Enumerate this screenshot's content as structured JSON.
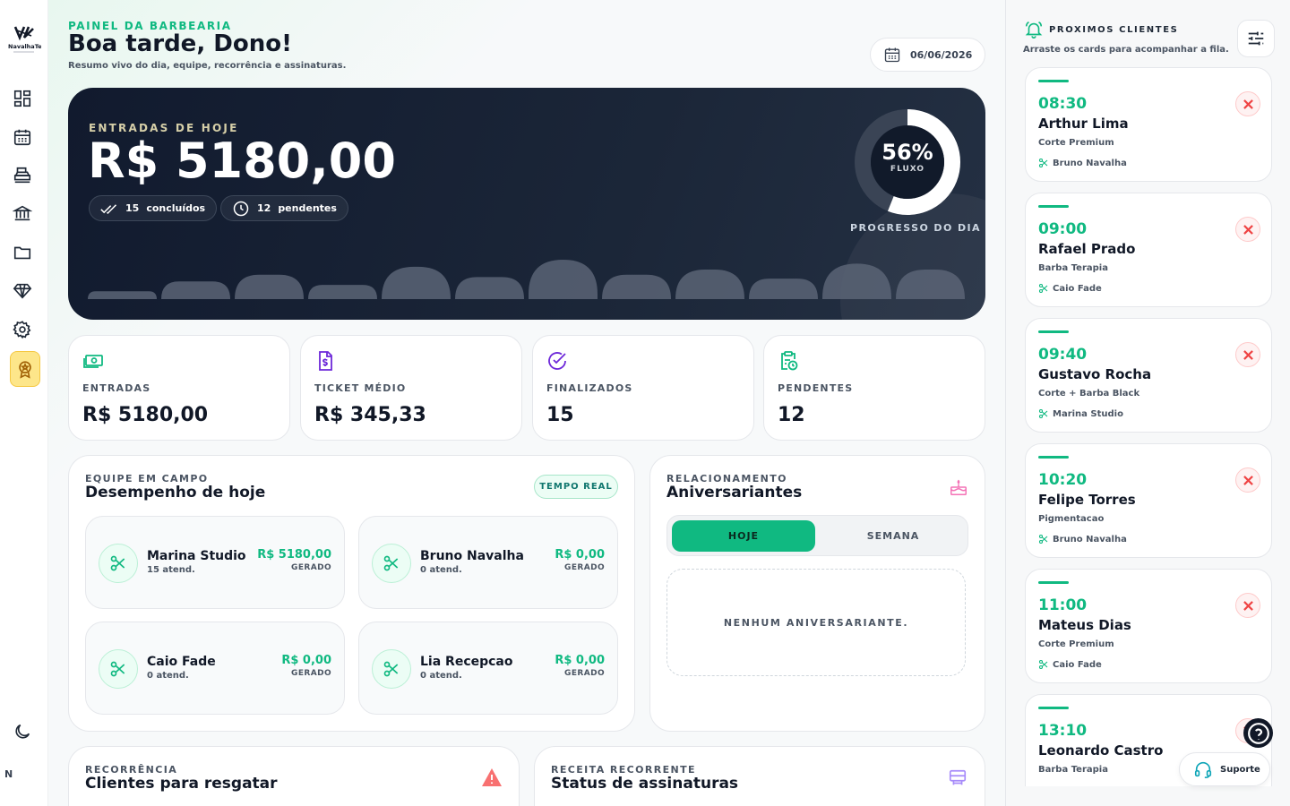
{
  "sidebar": {
    "logo_text": "NavalhaTec",
    "items": [
      {
        "icon": "dashboard-icon"
      },
      {
        "icon": "calendar-icon"
      },
      {
        "icon": "cash-register-icon"
      },
      {
        "icon": "bank-icon"
      },
      {
        "icon": "folder-icon"
      },
      {
        "icon": "diamond-icon"
      },
      {
        "icon": "gear-icon"
      },
      {
        "icon": "award-badge-icon"
      }
    ],
    "theme_icon": "moon-icon",
    "user_initial": "N"
  },
  "header": {
    "eyebrow": "PAINEL DA BARBEARIA",
    "title": "Boa tarde, Dono!",
    "subtitle": "Resumo vivo do dia, equipe, recorrência e assinaturas.",
    "date": "06/06/2026"
  },
  "hero": {
    "eyebrow": "ENTRADAS DE HOJE",
    "value": "R$ 5180,00",
    "chips": {
      "done_count": "15",
      "done_label": "concluídos",
      "pending_count": "12",
      "pending_label": "pendentes"
    },
    "progress": {
      "percent_text": "56%",
      "percent": 0.56,
      "label": "FLUXO",
      "caption": "PROGRESSO DO DIA"
    },
    "bars": [
      0.2,
      0.45,
      0.62,
      0.36,
      0.82,
      0.56,
      1.0,
      0.62,
      0.75,
      0.52,
      0.9,
      0.75
    ],
    "colors": {
      "track": "#3a4455",
      "fill": "#ffffff",
      "bar": "#5b6475"
    }
  },
  "stats": [
    {
      "label": "ENTRADAS",
      "value": "R$ 5180,00",
      "icon": "money-icon",
      "color": "#10b981"
    },
    {
      "label": "TICKET MÉDIO",
      "value": "R$ 345,33",
      "icon": "invoice-dollar-icon",
      "color": "#6d28d9"
    },
    {
      "label": "FINALIZADOS",
      "value": "15",
      "icon": "check-circle-icon",
      "color": "#6d28d9"
    },
    {
      "label": "PENDENTES",
      "value": "12",
      "icon": "clipboard-clock-icon",
      "color": "#10b981"
    }
  ],
  "team": {
    "eyebrow": "EQUIPE EM CAMPO",
    "title": "Desempenho de hoje",
    "badge": "TEMPO REAL",
    "members": [
      {
        "name": "Marina Studio",
        "count": "15 atend.",
        "amount": "R$ 5180,00",
        "tag": "GERADO"
      },
      {
        "name": "Bruno Navalha",
        "count": "0 atend.",
        "amount": "R$ 0,00",
        "tag": "GERADO"
      },
      {
        "name": "Caio Fade",
        "count": "0 atend.",
        "amount": "R$ 0,00",
        "tag": "GERADO"
      },
      {
        "name": "Lia Recepcao",
        "count": "0 atend.",
        "amount": "R$ 0,00",
        "tag": "GERADO"
      }
    ]
  },
  "birthdays": {
    "eyebrow": "RELACIONAMENTO",
    "title": "Aniversariantes",
    "icon": "cake-icon",
    "tabs": [
      "HOJE",
      "SEMANA"
    ],
    "selected": "HOJE",
    "empty": "NENHUM ANIVERSARIANTE."
  },
  "recurrence": {
    "eyebrow": "RECORRÊNCIA",
    "title": "Clientes para resgatar",
    "icon": "warning-icon"
  },
  "subscriptions": {
    "eyebrow": "RECEITA RECORRENTE",
    "title": "Status de assinaturas",
    "icon": "billing-icon"
  },
  "queue": {
    "title": "PROXIMOS CLIENTES",
    "subtitle": "Arraste os cards para acompanhar a fila.",
    "items": [
      {
        "time": "08:30",
        "client": "Arthur Lima",
        "service": "Corte Premium",
        "barber": "Bruno Navalha"
      },
      {
        "time": "09:00",
        "client": "Rafael Prado",
        "service": "Barba Terapia",
        "barber": "Caio Fade"
      },
      {
        "time": "09:40",
        "client": "Gustavo Rocha",
        "service": "Corte + Barba Black",
        "barber": "Marina Studio"
      },
      {
        "time": "10:20",
        "client": "Felipe Torres",
        "service": "Pigmentacao",
        "barber": "Bruno Navalha"
      },
      {
        "time": "11:00",
        "client": "Mateus Dias",
        "service": "Corte Premium",
        "barber": "Caio Fade"
      },
      {
        "time": "13:10",
        "client": "Leonardo Castro",
        "service": "Barba Terapia",
        "barber": ""
      }
    ]
  },
  "support": {
    "label": "Suporte",
    "help_icon": "help-circle-icon"
  }
}
